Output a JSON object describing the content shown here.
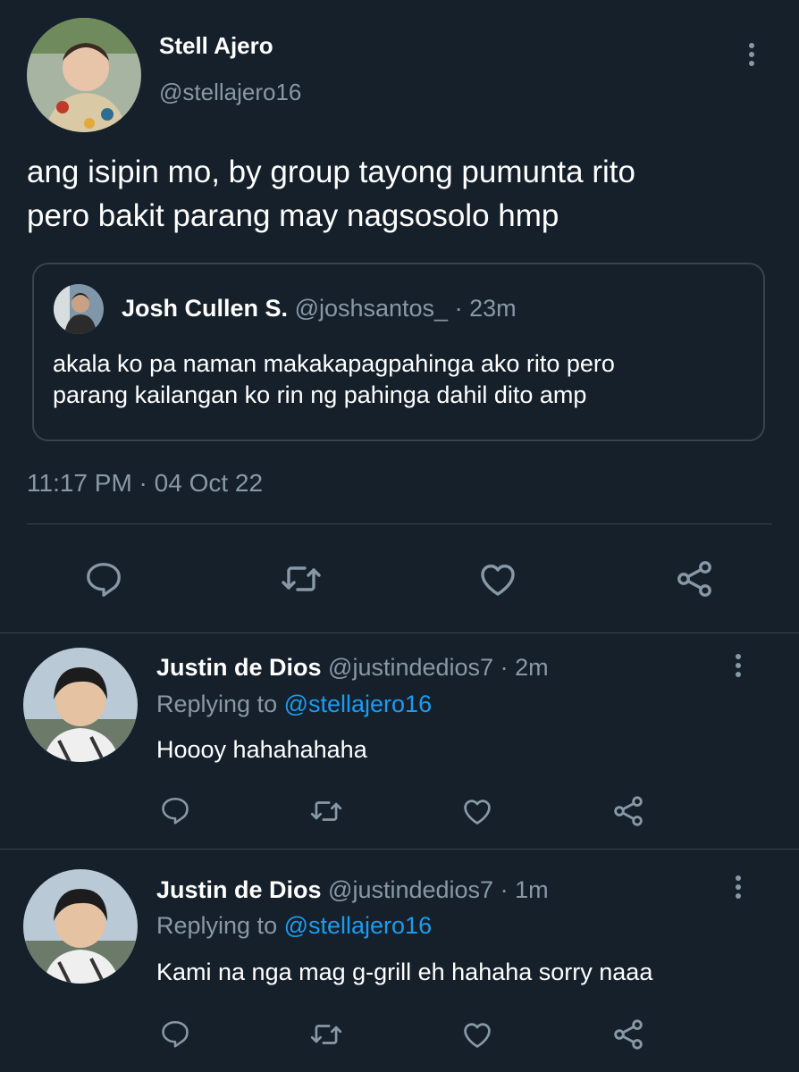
{
  "colors": {
    "background": "#15202b",
    "text": "#ffffff",
    "muted": "#8899a6",
    "link": "#1d9bf0",
    "divider": "#38444d"
  },
  "main_tweet": {
    "display_name": "Stell Ajero",
    "handle": "@stellajero16",
    "text_line1": "ang isipin mo, by group tayong pumunta rito",
    "text_line2": "pero bakit parang may nagsosolo hmp",
    "timestamp": "11:17 PM · 04 Oct 22",
    "quoted": {
      "display_name": "Josh Cullen S.",
      "handle": "@joshsantos_",
      "time": "· 23m",
      "text_line1": "akala ko pa naman makakapagpahinga ako rito pero",
      "text_line2": "parang kailangan ko rin ng pahinga dahil dito amp"
    },
    "actions": [
      "reply-icon",
      "retweet-icon",
      "like-icon",
      "share-icon"
    ]
  },
  "replies": [
    {
      "display_name": "Justin de Dios",
      "handle": "@justindedios7",
      "time": "· 2m",
      "replying_prefix": "Replying to ",
      "replying_to": "@stellajero16",
      "text": "Hoooy hahahahaha"
    },
    {
      "display_name": "Justin de Dios",
      "handle": "@justindedios7",
      "time": "· 1m",
      "replying_prefix": "Replying to ",
      "replying_to": "@stellajero16",
      "text": "Kami na nga mag g-grill eh hahaha sorry naaa"
    }
  ]
}
